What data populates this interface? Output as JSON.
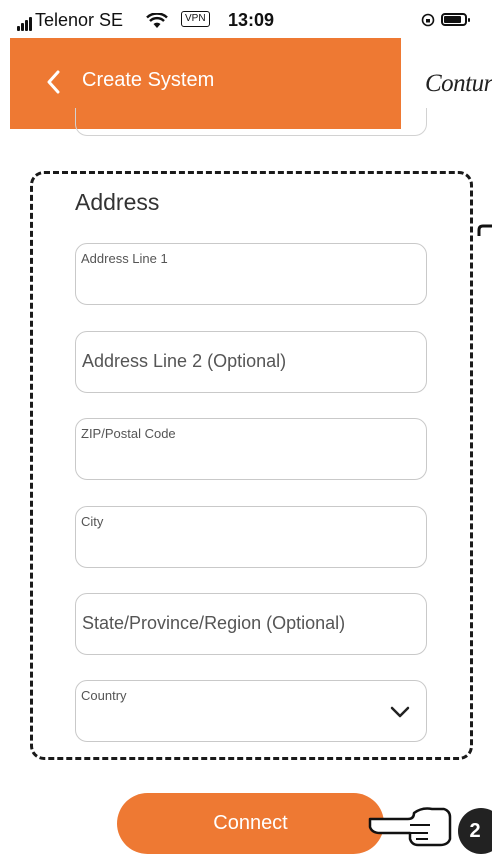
{
  "status_bar": {
    "carrier": "Telenor SE",
    "vpn": "VPN",
    "time": "13:09"
  },
  "header": {
    "title": "Create System",
    "logo": "Contura",
    "back_icon": "chevron-left-icon"
  },
  "form": {
    "section_title": "Address",
    "fields": [
      {
        "label": "Address Line 1",
        "style": "floating-label"
      },
      {
        "placeholder": "Address Line 2 (Optional)",
        "style": "placeholder"
      },
      {
        "label": "ZIP/Postal Code",
        "style": "floating-label"
      },
      {
        "label": "City",
        "style": "floating-label"
      },
      {
        "placeholder": "State/Province/Region (Optional)",
        "style": "placeholder"
      },
      {
        "label": "Country",
        "style": "floating-label",
        "icon": "chevron-down-icon"
      }
    ]
  },
  "connect_button": {
    "label": "Connect"
  },
  "annotation": {
    "step": "2",
    "icon": "pointing-hand-icon"
  },
  "colors": {
    "accent": "#ee7933",
    "frame": "#1a1a1a"
  }
}
